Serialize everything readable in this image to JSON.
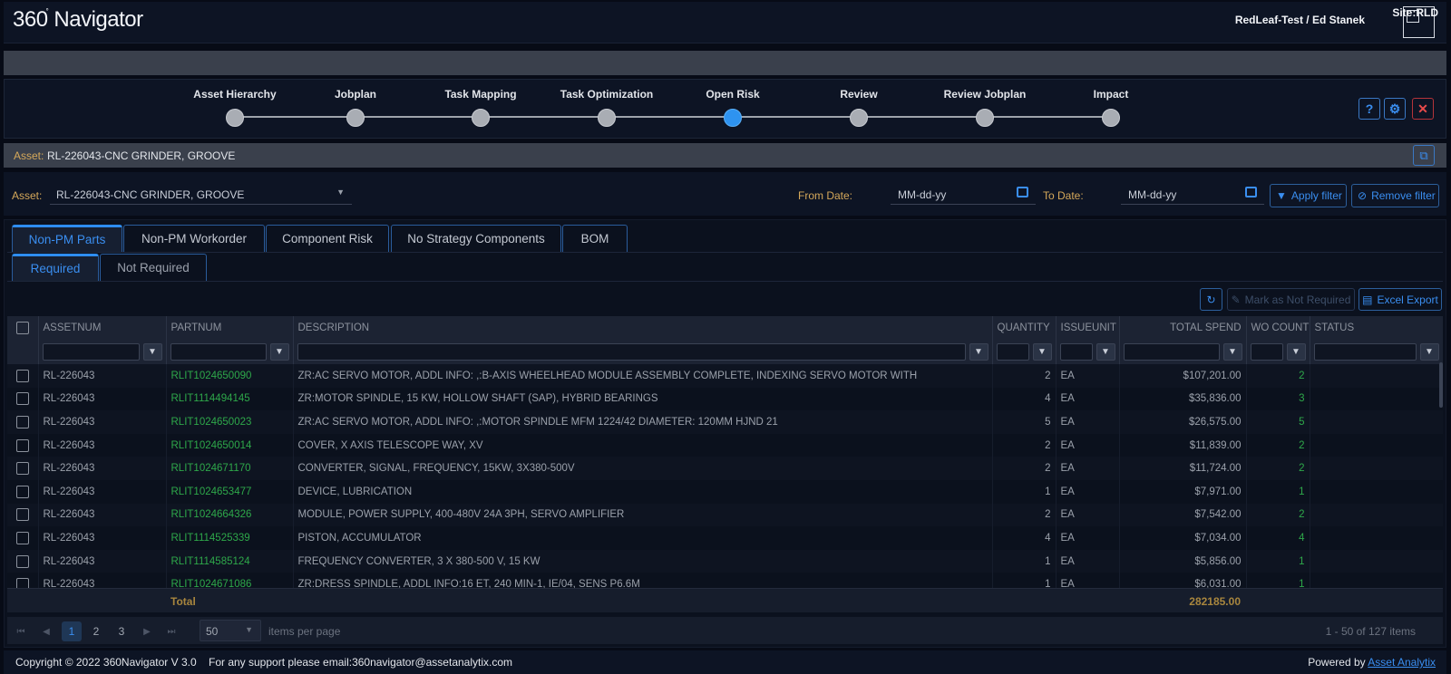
{
  "app": {
    "logo_prefix": "360",
    "logo_name": "Navigator",
    "user": "RedLeaf-Test / Ed Stanek",
    "site": "Site:RLD"
  },
  "steps": [
    {
      "label": "Asset Hierarchy"
    },
    {
      "label": "Jobplan"
    },
    {
      "label": "Task Mapping"
    },
    {
      "label": "Task Optimization"
    },
    {
      "label": "Open Risk",
      "active": true
    },
    {
      "label": "Review"
    },
    {
      "label": "Review Jobplan"
    },
    {
      "label": "Impact"
    }
  ],
  "asset_bar": {
    "key": "Asset:",
    "value": "RL-226043-CNC GRINDER, GROOVE"
  },
  "filters": {
    "asset_label": "Asset:",
    "asset_value": "RL-226043-CNC GRINDER, GROOVE",
    "from_label": "From Date:",
    "from_placeholder": "MM-dd-yy",
    "to_label": "To Date:",
    "to_placeholder": "MM-dd-yy",
    "apply": "Apply filter",
    "remove": "Remove filter"
  },
  "tabs": [
    "Non-PM Parts",
    "Non-PM Workorder",
    "Component Risk",
    "No Strategy Components",
    "BOM"
  ],
  "subtabs": [
    "Required",
    "Not Required"
  ],
  "toolbar": {
    "mark": "Mark as Not Required",
    "export": "Excel Export"
  },
  "grid": {
    "columns": [
      "ASSETNUM",
      "PARTNUM",
      "DESCRIPTION",
      "QUANTITY",
      "ISSUEUNIT",
      "TOTAL SPEND",
      "WO COUNT",
      "STATUS"
    ],
    "rows": [
      [
        "RL-226043",
        "RLIT1024650090",
        "ZR:AC SERVO MOTOR, ADDL INFO: ,:B-AXIS WHEELHEAD MODULE ASSEMBLY COMPLETE, INDEXING SERVO MOTOR WITH",
        "2",
        "EA",
        "$107,201.00",
        "2",
        ""
      ],
      [
        "RL-226043",
        "RLIT1114494145",
        "ZR:MOTOR SPINDLE, 15 KW, HOLLOW SHAFT (SAP), HYBRID BEARINGS",
        "4",
        "EA",
        "$35,836.00",
        "3",
        ""
      ],
      [
        "RL-226043",
        "RLIT1024650023",
        "ZR:AC SERVO MOTOR, ADDL INFO: ,:MOTOR SPINDLE MFM 1224/42 DIAMETER: 120MM HJND 21",
        "5",
        "EA",
        "$26,575.00",
        "5",
        ""
      ],
      [
        "RL-226043",
        "RLIT1024650014",
        "COVER, X AXIS TELESCOPE WAY, XV",
        "2",
        "EA",
        "$11,839.00",
        "2",
        ""
      ],
      [
        "RL-226043",
        "RLIT1024671170",
        "CONVERTER, SIGNAL, FREQUENCY, 15KW, 3X380-500V",
        "2",
        "EA",
        "$11,724.00",
        "2",
        ""
      ],
      [
        "RL-226043",
        "RLIT1024653477",
        "DEVICE, LUBRICATION",
        "1",
        "EA",
        "$7,971.00",
        "1",
        ""
      ],
      [
        "RL-226043",
        "RLIT1024664326",
        "MODULE, POWER SUPPLY, 400-480V 24A 3PH, SERVO AMPLIFIER",
        "2",
        "EA",
        "$7,542.00",
        "2",
        ""
      ],
      [
        "RL-226043",
        "RLIT1114525339",
        "PISTON, ACCUMULATOR",
        "4",
        "EA",
        "$7,034.00",
        "4",
        ""
      ],
      [
        "RL-226043",
        "RLIT1114585124",
        "FREQUENCY CONVERTER, 3 X 380-500 V, 15 KW",
        "1",
        "EA",
        "$5,856.00",
        "1",
        ""
      ],
      [
        "RL-226043",
        "RLIT1024671086",
        "ZR:DRESS SPINDLE, ADDL INFO:16 ET, 240 MIN-1, IE/04, SENS P6.6M",
        "1",
        "EA",
        "$6,031.00",
        "1",
        ""
      ]
    ],
    "total_label": "Total",
    "total_value": "282185.00"
  },
  "pager": {
    "pages": [
      "1",
      "2",
      "3"
    ],
    "size": "50",
    "size_label": "items per page",
    "info": "1 - 50 of 127 items"
  },
  "footer": {
    "copyright": "Copyright © 2022 360Navigator V 3.0",
    "support": "For any support please email:360navigator@assetanalytix.com",
    "powered_by": "Powered by",
    "company": "Asset Analytix"
  }
}
